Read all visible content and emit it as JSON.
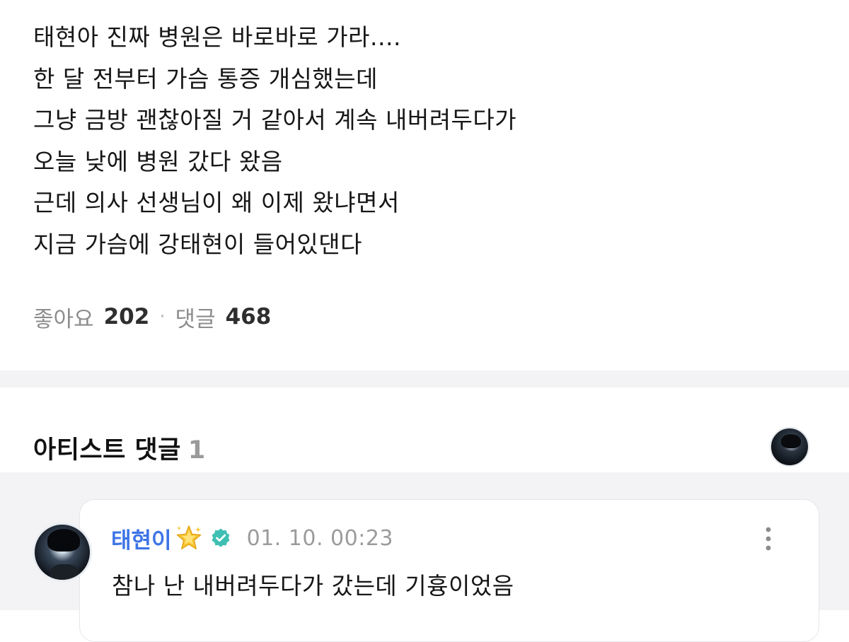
{
  "post": {
    "lines": [
      "태현아 진짜 병원은 바로바로 가라....",
      "한 달 전부터 가슴 통증 개심했는데",
      "그냥 금방 괜찮아질 거 같아서 계속 내버려두다가",
      "오늘 낮에 병원 갔다 왔음",
      "근데 의사 선생님이 왜 이제 왔냐면서",
      "지금 가슴에 강태현이 들어있댄다"
    ]
  },
  "stats": {
    "likes_label": "좋아요",
    "likes_count": "202",
    "separator": "·",
    "comments_label": "댓글",
    "comments_count": "468"
  },
  "artist_section": {
    "title": "아티스트 댓글",
    "count": "1"
  },
  "comment": {
    "author": "태현이",
    "badge_icon": "sparkle-star-icon",
    "verified_icon": "verified-check-icon",
    "time": "01. 10. 00:23",
    "text": "참나 난 내버려두다가 갔는데 기흉이었음"
  },
  "colors": {
    "author_name": "#3d74e6",
    "verified_badge": "#3fbfb3",
    "star": "#f7c531",
    "muted": "#8d8d8d",
    "section_bg": "#f3f3f5"
  }
}
